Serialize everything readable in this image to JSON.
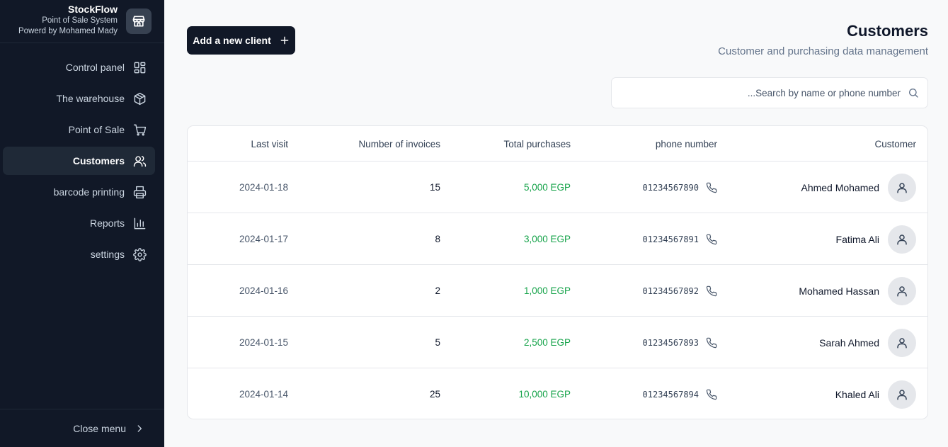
{
  "brand": {
    "name": "StockFlow",
    "subtitle": "Point of Sale System",
    "powered_by": "Powerd by Mohamed Mady",
    "logo_icon": "store-icon"
  },
  "nav": {
    "items": [
      {
        "label": "Control panel",
        "icon": "dashboard-icon",
        "active": false
      },
      {
        "label": "The warehouse",
        "icon": "box-icon",
        "active": false
      },
      {
        "label": "Point of Sale",
        "icon": "cart-icon",
        "active": false
      },
      {
        "label": "Customers",
        "icon": "users-icon",
        "active": true
      },
      {
        "label": "barcode printing",
        "icon": "printer-icon",
        "active": false
      },
      {
        "label": "Reports",
        "icon": "bar-chart-icon",
        "active": false
      },
      {
        "label": "settings",
        "icon": "gear-icon",
        "active": false
      }
    ],
    "close_label": "Close menu"
  },
  "header": {
    "add_button_label": "Add a new client",
    "title": "Customers",
    "subtitle": "Customer and purchasing data management"
  },
  "search": {
    "placeholder": "...Search by name or phone number",
    "value": ""
  },
  "table": {
    "columns": {
      "last_visit": "Last visit",
      "invoices": "Number of invoices",
      "total": "Total purchases",
      "phone": "phone number",
      "customer": "Customer"
    },
    "rows": [
      {
        "name": "Ahmed Mohamed",
        "phone": "01234567890",
        "total": "5,000 EGP",
        "invoices": "15",
        "last_visit": "2024-01-18"
      },
      {
        "name": "Fatima Ali",
        "phone": "01234567891",
        "total": "3,000 EGP",
        "invoices": "8",
        "last_visit": "2024-01-17"
      },
      {
        "name": "Mohamed Hassan",
        "phone": "01234567892",
        "total": "1,000 EGP",
        "invoices": "2",
        "last_visit": "2024-01-16"
      },
      {
        "name": "Sarah Ahmed",
        "phone": "01234567893",
        "total": "2,500 EGP",
        "invoices": "5",
        "last_visit": "2024-01-15"
      },
      {
        "name": "Khaled Ali",
        "phone": "01234567894",
        "total": "10,000 EGP",
        "invoices": "25",
        "last_visit": "2024-01-14"
      }
    ]
  },
  "colors": {
    "sidebar_bg": "#111827",
    "accent_dark": "#111827",
    "money_green": "#16a34a"
  }
}
